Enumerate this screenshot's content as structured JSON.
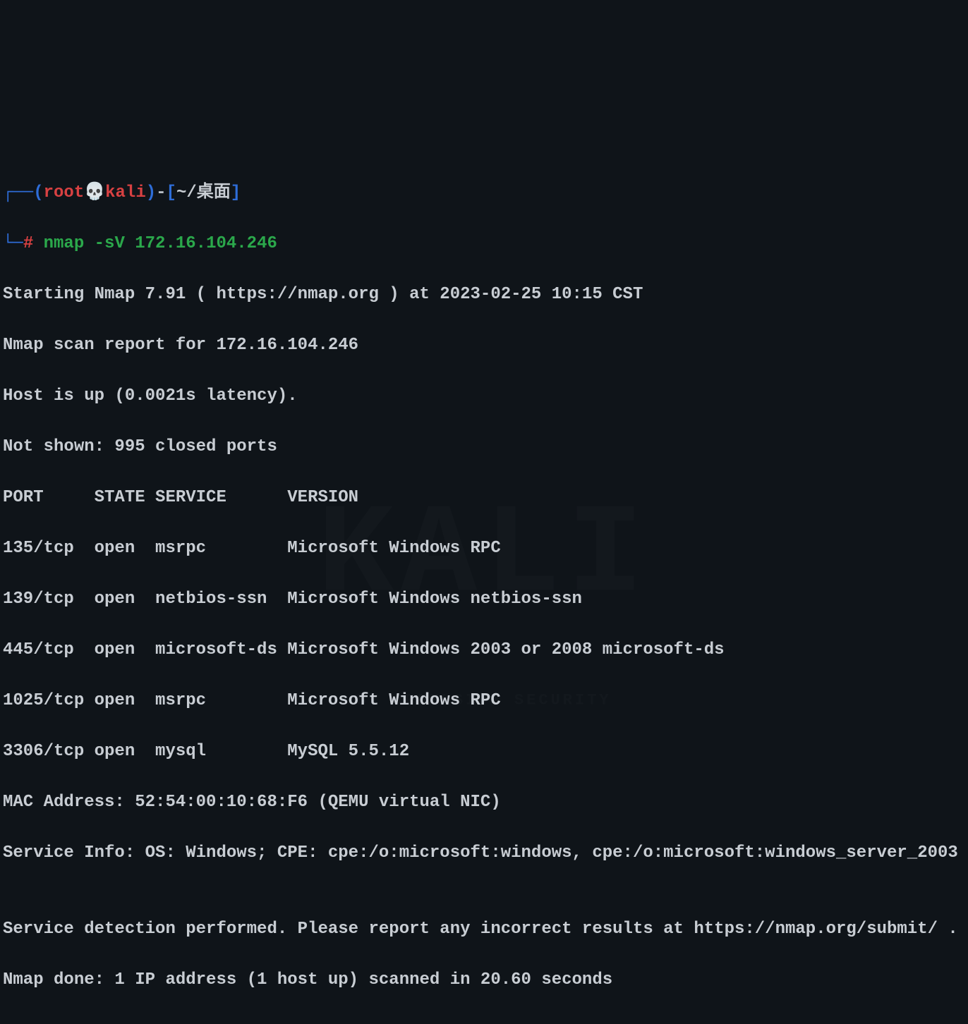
{
  "prompt": {
    "open_paren": "(",
    "user": "root",
    "skull": "💀",
    "host": "kali",
    "close_paren": ")",
    "dash": "-",
    "open_bracket": "[",
    "path": "~/桌面",
    "close_bracket": "]",
    "corner_top": "┌──",
    "corner_bottom": "└─",
    "hash": "#",
    "command": "nmap -sV 172.16.104.246"
  },
  "output": {
    "starting": "Starting Nmap 7.91 ( https://nmap.org ) at 2023-02-25 10:15 CST",
    "scan_report": "Nmap scan report for 172.16.104.246",
    "host_up": "Host is up (0.0021s latency).",
    "not_shown": "Not shown: 995 closed ports",
    "header": "PORT     STATE SERVICE      VERSION",
    "rows": [
      "135/tcp  open  msrpc        Microsoft Windows RPC",
      "139/tcp  open  netbios-ssn  Microsoft Windows netbios-ssn",
      "445/tcp  open  microsoft-ds Microsoft Windows 2003 or 2008 microsoft-ds",
      "1025/tcp open  msrpc        Microsoft Windows RPC",
      "3306/tcp open  mysql        MySQL 5.5.12"
    ],
    "mac": "MAC Address: 52:54:00:10:68:F6 (QEMU virtual NIC)",
    "service_info": "Service Info: OS: Windows; CPE: cpe:/o:microsoft:windows, cpe:/o:microsoft:windows_server_2003",
    "blank": "",
    "detection": "Service detection performed. Please report any incorrect results at https://nmap.org/submit/ .",
    "done": "Nmap done: 1 IP address (1 host up) scanned in 20.60 seconds"
  },
  "watermark": {
    "main": "KALI",
    "sub": "BY OFFENSIVE SECURITY"
  }
}
